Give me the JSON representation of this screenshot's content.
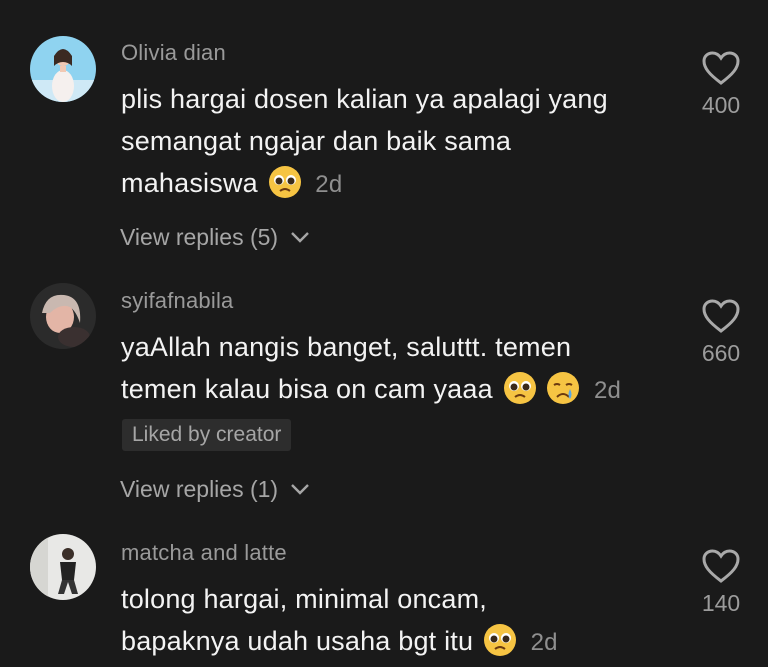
{
  "comments": [
    {
      "username": "Olivia dian",
      "text_lines": [
        "plis hargai dosen kalian ya apalagi yang",
        "semangat ngajar dan baik sama",
        "mahasiswa"
      ],
      "age": "2d",
      "replies_label": "View replies (5)",
      "likes": "400"
    },
    {
      "username": "syifafnabila",
      "text_lines": [
        "yaAllah nangis banget, saluttt. temen",
        "temen kalau bisa on cam yaaa"
      ],
      "age": "2d",
      "badge": "Liked by creator",
      "replies_label": "View replies (1)",
      "likes": "660"
    },
    {
      "username": "matcha and latte",
      "text_lines": [
        "tolong hargai, minimal oncam,",
        "bapaknya udah usaha bgt itu"
      ],
      "age": "2d",
      "likes": "140"
    }
  ],
  "colors": {
    "background": "#1a1a1a",
    "text": "#f3f3f3",
    "muted": "#9a9a9a",
    "badge_bg": "#2d2d2d"
  },
  "icons": [
    "heart-outline-icon",
    "chevron-down-icon",
    "pleading-face-emoji",
    "crying-face-emoji"
  ]
}
